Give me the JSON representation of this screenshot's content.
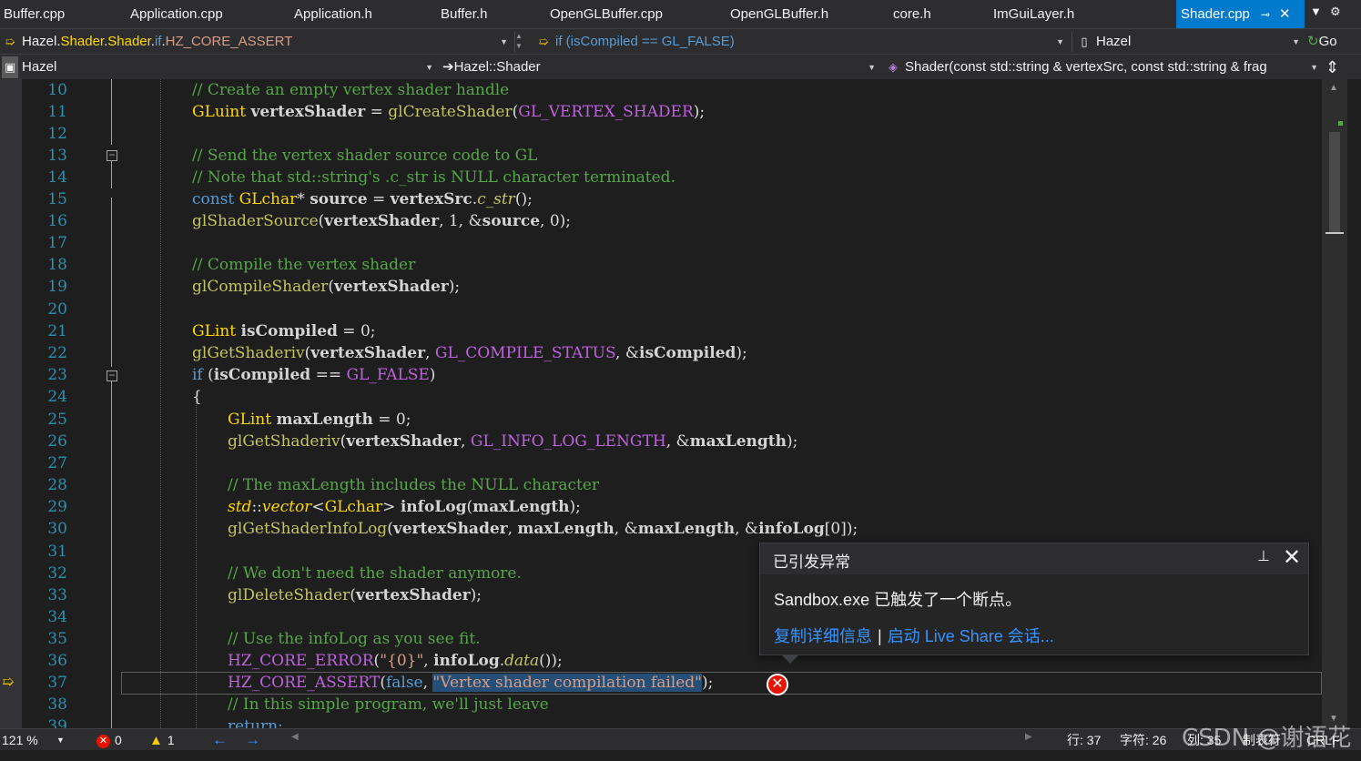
{
  "tabs": [
    {
      "label": "Buffer.cpp",
      "active": false
    },
    {
      "label": "Application.cpp",
      "active": false
    },
    {
      "label": "Application.h",
      "active": false
    },
    {
      "label": "Buffer.h",
      "active": false
    },
    {
      "label": "OpenGLBuffer.cpp",
      "active": false
    },
    {
      "label": "OpenGLBuffer.h",
      "active": false
    },
    {
      "label": "core.h",
      "active": false
    },
    {
      "label": "ImGuiLayer.h",
      "active": false
    },
    {
      "label": "Shader.cpp",
      "active": true
    }
  ],
  "nav1": {
    "scope_prefix": "Hazel.",
    "scope_mid1": "Shader",
    "scope_dot1": ".",
    "scope_mid2": "Shader",
    "scope_dot2": ".",
    "scope_if": "if",
    "scope_dot3": ".",
    "scope_macro": "HZ_CORE_ASSERT",
    "condition_kw": "if",
    "condition_text": " (isCompiled == GL_FALSE)",
    "project": "Hazel",
    "go_label": "Go"
  },
  "nav2": {
    "project": "Hazel",
    "class": "Hazel::Shader",
    "member": "Shader(const std::string & vertexSrc, const std::string & frag"
  },
  "line_numbers": [
    "10",
    "11",
    "12",
    "13",
    "14",
    "15",
    "16",
    "17",
    "18",
    "19",
    "20",
    "21",
    "22",
    "23",
    "24",
    "25",
    "26",
    "27",
    "28",
    "29",
    "30",
    "31",
    "32",
    "33",
    "34",
    "35",
    "36",
    "37",
    "38",
    "39"
  ],
  "code": {
    "l10": "// Create an empty vertex shader handle",
    "l11_type": "GLuint",
    "l11_var": "vertexShader",
    "l11_eq": " = ",
    "l11_fn": "glCreateShader",
    "l11_arg": "GL_VERTEX_SHADER",
    "l13": "// Send the vertex shader source code to GL",
    "l14": "// Note that std::string's .c_str is NULL character terminated.",
    "l15_kw": "const",
    "l15_type": "GLchar",
    "l15_star": "* ",
    "l15_var": "source",
    "l15_eq": " = ",
    "l15_obj": "vertexSrc",
    "l15_dot": ".",
    "l15_fn": "c_str",
    "l15_end": "();",
    "l16_fn": "glShaderSource",
    "l16_a1": "vertexShader",
    "l16_mid": ", 1, &",
    "l16_a2": "source",
    "l16_end": ", 0);",
    "l18": "// Compile the vertex shader",
    "l19_fn": "glCompileShader",
    "l19_arg": "vertexShader",
    "l21_type": "GLint",
    "l21_var": "isCompiled",
    "l21_end": " = 0;",
    "l22_fn": "glGetShaderiv",
    "l22_a1": "vertexShader",
    "l22_mac": "GL_COMPILE_STATUS",
    "l22_a2": "isCompiled",
    "l23_kw": "if",
    "l23_var": "isCompiled",
    "l23_mac": "GL_FALSE",
    "l24": "{",
    "l25_type": "GLint",
    "l25_var": "maxLength",
    "l25_end": " = 0;",
    "l26_fn": "glGetShaderiv",
    "l26_a1": "vertexShader",
    "l26_mac": "GL_INFO_LOG_LENGTH",
    "l26_a2": "maxLength",
    "l28": "// The maxLength includes the NULL character",
    "l29_ns": "std",
    "l29_cls": "vector",
    "l29_type": "GLchar",
    "l29_var": "infoLog",
    "l29_arg": "maxLength",
    "l30_fn": "glGetShaderInfoLog",
    "l30_a1": "vertexShader",
    "l30_a2": "maxLength",
    "l30_a3": "maxLength",
    "l30_a4": "infoLog",
    "l32": "// We don't need the shader anymore.",
    "l33_fn": "glDeleteShader",
    "l33_arg": "vertexShader",
    "l35": "// Use the infoLog as you see fit.",
    "l36_mac": "HZ_CORE_ERROR",
    "l36_str": "\"{0}\"",
    "l36_obj": "infoLog",
    "l36_fn": "data",
    "l37_mac": "HZ_CORE_ASSERT",
    "l37_kw": "false",
    "l37_str": "\"Vertex shader compilation failed\"",
    "l38": "// In this simple program, we'll just leave",
    "l39": "return;"
  },
  "exception": {
    "title": "已引发异常",
    "message": "Sandbox.exe 已触发了一个断点。",
    "link_copy": "复制详细信息",
    "link_liveshare": "启动 Live Share 会话..."
  },
  "status": {
    "zoom": "121 %",
    "errors": "0",
    "warnings": "1",
    "line": "行: 37",
    "char": "字符: 26",
    "col": "列: 35",
    "encoding": "制表符",
    "eol": "CRLF"
  },
  "watermark": "CSDN @谢语花",
  "colors": {
    "accent": "#007acc",
    "background": "#1e1e1e",
    "comment": "#57a64a",
    "keyword": "#569cd6",
    "function": "#c5c561",
    "macro": "#be63dd",
    "string": "#d69d85",
    "line_number": "#2b91af",
    "error": "#e51400",
    "link": "#3794ff"
  }
}
